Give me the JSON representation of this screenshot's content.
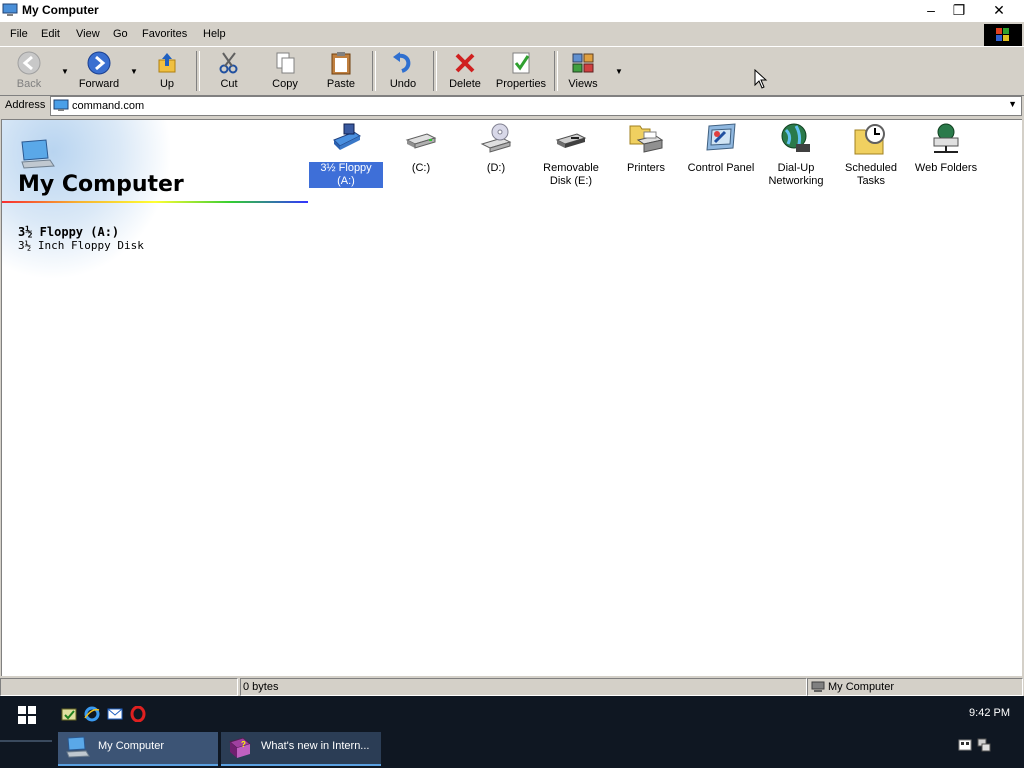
{
  "window": {
    "title": "My Computer"
  },
  "title_buttons": {
    "minimize": "–",
    "restore": "❐",
    "close": "✕"
  },
  "menu": [
    "File",
    "Edit",
    "View",
    "Go",
    "Favorites",
    "Help"
  ],
  "toolbar": {
    "back": "Back",
    "forward": "Forward",
    "up": "Up",
    "cut": "Cut",
    "copy": "Copy",
    "paste": "Paste",
    "undo": "Undo",
    "delete": "Delete",
    "properties": "Properties",
    "views": "Views"
  },
  "address": {
    "label": "Address",
    "value": "command.com"
  },
  "left_pane": {
    "title": "My Computer",
    "selected_name": "3½ Floppy (A:)",
    "selected_desc": "3½ Inch Floppy Disk"
  },
  "items": [
    {
      "label": "3½ Floppy (A:)",
      "icon": "floppy-drive-icon",
      "selected": true
    },
    {
      "label": "(C:)",
      "icon": "hard-drive-icon"
    },
    {
      "label": "(D:)",
      "icon": "cd-drive-icon"
    },
    {
      "label": "Removable Disk (E:)",
      "icon": "removable-disk-icon"
    },
    {
      "label": "Printers",
      "icon": "printers-folder-icon"
    },
    {
      "label": "Control Panel",
      "icon": "control-panel-icon"
    },
    {
      "label": "Dial-Up Networking",
      "icon": "dialup-networking-icon"
    },
    {
      "label": "Scheduled Tasks",
      "icon": "scheduled-tasks-icon"
    },
    {
      "label": "Web Folders",
      "icon": "web-folders-icon"
    }
  ],
  "status": {
    "size": "0 bytes",
    "zone": "My Computer"
  },
  "taskbar": {
    "clock": "9:42 PM",
    "tasks": [
      {
        "title": "My Computer"
      },
      {
        "title": "What's new in Intern..."
      }
    ]
  },
  "colors": {
    "selection": "#3e6fd8",
    "taskbar": "#0f1722",
    "chrome": "#d4d0c8"
  }
}
